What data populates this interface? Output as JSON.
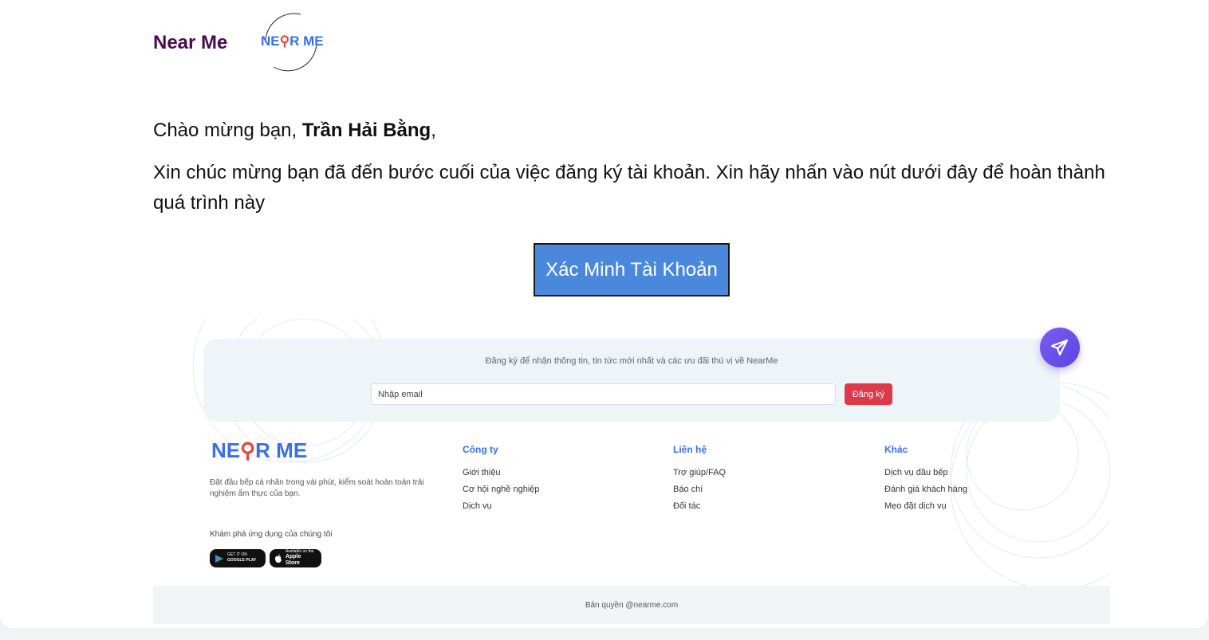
{
  "header": {
    "brand_name": "Near Me",
    "logo_text_part1": "NE",
    "logo_text_part2": "R ME"
  },
  "greeting": {
    "prefix": "Chào mừng bạn, ",
    "user_name": "Trần Hải Bằng",
    "suffix": ","
  },
  "message": "Xin chúc mừng bạn đã đến bước cuối của việc đăng ký tài khoản. Xin hãy nhấn vào nút dưới đây để hoàn thành quá trình này",
  "verify_button": "Xác Minh Tài Khoản",
  "newsletter": {
    "title": "Đăng ký để nhận thông tin, tin tức mới nhất và các ưu đãi thú vị về NearMe",
    "email_placeholder": "Nhập email",
    "subscribe_label": "Đăng ký"
  },
  "footer": {
    "logo_part1": "NE",
    "logo_part2": "R ME",
    "description": "Đặt đầu bếp cá nhân trong vài phút, kiểm soát hoàn toàn trải nghiệm ẩm thực của bạn.",
    "app_heading": "Khám phá ứng dụng của chúng tôi",
    "google_play": {
      "small": "GET IT ON",
      "big": "GOOGLE PLAY"
    },
    "apple_store": {
      "small": "Available on the",
      "big": "Apple Store"
    },
    "columns": [
      {
        "title": "Công ty",
        "links": [
          "Giới thiệu",
          "Cơ hội nghề nghiệp",
          "Dịch vụ"
        ]
      },
      {
        "title": "Liên hệ",
        "links": [
          "Trợ giúp/FAQ",
          "Báo chí",
          "Đối tác"
        ]
      },
      {
        "title": "Khác",
        "links": [
          "Dịch vụ đầu bếp",
          "Đánh giá khách hàng",
          "Mẹo đặt dịch vụ"
        ]
      }
    ],
    "copyright": "Bản quyền @nearme.com"
  },
  "icons": {
    "map_pin": "map-pin-icon",
    "send": "send-icon",
    "play": "play-store-icon",
    "apple": "apple-icon"
  },
  "colors": {
    "brand_purple": "#4a0a4e",
    "brand_blue": "#3a6fe8",
    "button_blue": "#4a88dc",
    "subscribe_red": "#dc3a4a",
    "fab_purple": "#6a50ea"
  }
}
